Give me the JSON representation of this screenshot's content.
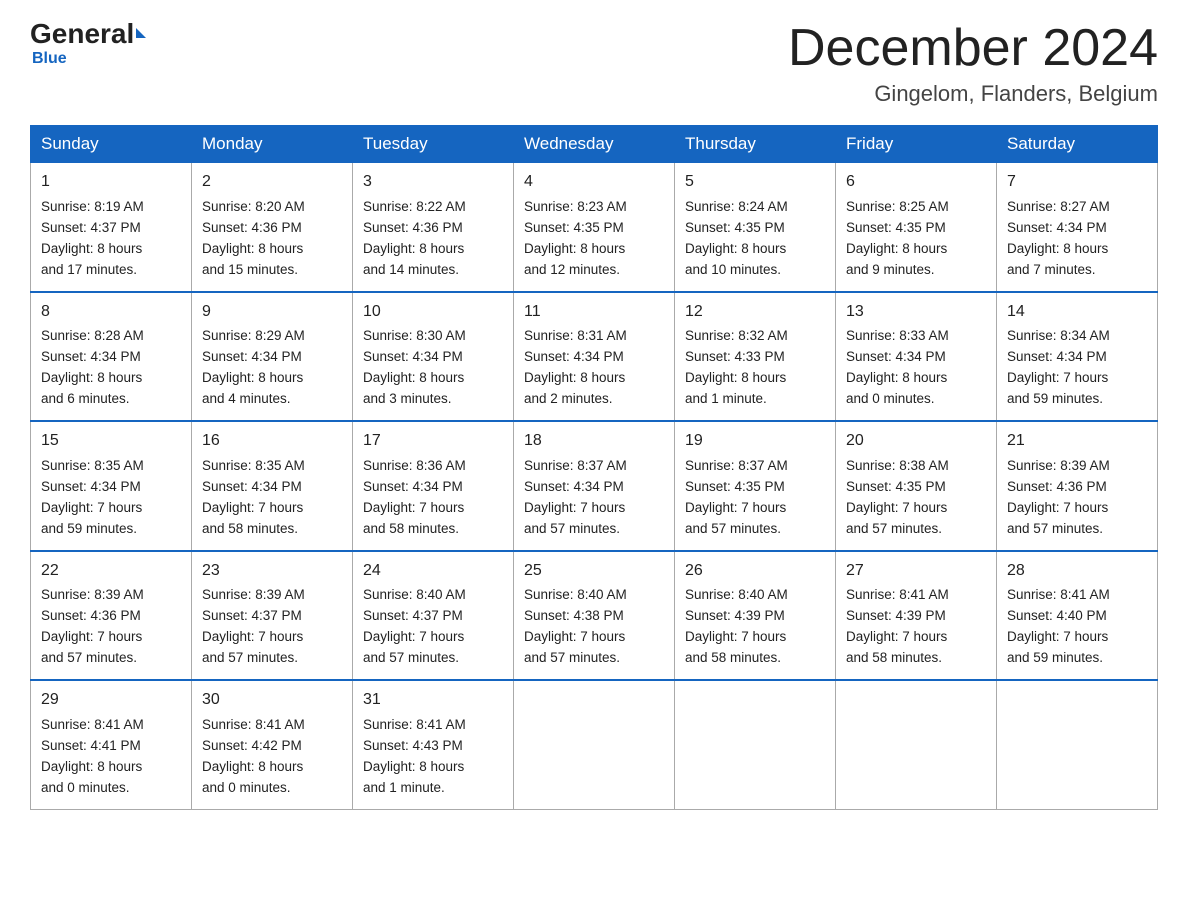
{
  "logo": {
    "general": "General",
    "blue": "Blue"
  },
  "header": {
    "month": "December 2024",
    "location": "Gingelom, Flanders, Belgium"
  },
  "weekdays": [
    "Sunday",
    "Monday",
    "Tuesday",
    "Wednesday",
    "Thursday",
    "Friday",
    "Saturday"
  ],
  "weeks": [
    [
      {
        "day": "1",
        "info": "Sunrise: 8:19 AM\nSunset: 4:37 PM\nDaylight: 8 hours\nand 17 minutes."
      },
      {
        "day": "2",
        "info": "Sunrise: 8:20 AM\nSunset: 4:36 PM\nDaylight: 8 hours\nand 15 minutes."
      },
      {
        "day": "3",
        "info": "Sunrise: 8:22 AM\nSunset: 4:36 PM\nDaylight: 8 hours\nand 14 minutes."
      },
      {
        "day": "4",
        "info": "Sunrise: 8:23 AM\nSunset: 4:35 PM\nDaylight: 8 hours\nand 12 minutes."
      },
      {
        "day": "5",
        "info": "Sunrise: 8:24 AM\nSunset: 4:35 PM\nDaylight: 8 hours\nand 10 minutes."
      },
      {
        "day": "6",
        "info": "Sunrise: 8:25 AM\nSunset: 4:35 PM\nDaylight: 8 hours\nand 9 minutes."
      },
      {
        "day": "7",
        "info": "Sunrise: 8:27 AM\nSunset: 4:34 PM\nDaylight: 8 hours\nand 7 minutes."
      }
    ],
    [
      {
        "day": "8",
        "info": "Sunrise: 8:28 AM\nSunset: 4:34 PM\nDaylight: 8 hours\nand 6 minutes."
      },
      {
        "day": "9",
        "info": "Sunrise: 8:29 AM\nSunset: 4:34 PM\nDaylight: 8 hours\nand 4 minutes."
      },
      {
        "day": "10",
        "info": "Sunrise: 8:30 AM\nSunset: 4:34 PM\nDaylight: 8 hours\nand 3 minutes."
      },
      {
        "day": "11",
        "info": "Sunrise: 8:31 AM\nSunset: 4:34 PM\nDaylight: 8 hours\nand 2 minutes."
      },
      {
        "day": "12",
        "info": "Sunrise: 8:32 AM\nSunset: 4:33 PM\nDaylight: 8 hours\nand 1 minute."
      },
      {
        "day": "13",
        "info": "Sunrise: 8:33 AM\nSunset: 4:34 PM\nDaylight: 8 hours\nand 0 minutes."
      },
      {
        "day": "14",
        "info": "Sunrise: 8:34 AM\nSunset: 4:34 PM\nDaylight: 7 hours\nand 59 minutes."
      }
    ],
    [
      {
        "day": "15",
        "info": "Sunrise: 8:35 AM\nSunset: 4:34 PM\nDaylight: 7 hours\nand 59 minutes."
      },
      {
        "day": "16",
        "info": "Sunrise: 8:35 AM\nSunset: 4:34 PM\nDaylight: 7 hours\nand 58 minutes."
      },
      {
        "day": "17",
        "info": "Sunrise: 8:36 AM\nSunset: 4:34 PM\nDaylight: 7 hours\nand 58 minutes."
      },
      {
        "day": "18",
        "info": "Sunrise: 8:37 AM\nSunset: 4:34 PM\nDaylight: 7 hours\nand 57 minutes."
      },
      {
        "day": "19",
        "info": "Sunrise: 8:37 AM\nSunset: 4:35 PM\nDaylight: 7 hours\nand 57 minutes."
      },
      {
        "day": "20",
        "info": "Sunrise: 8:38 AM\nSunset: 4:35 PM\nDaylight: 7 hours\nand 57 minutes."
      },
      {
        "day": "21",
        "info": "Sunrise: 8:39 AM\nSunset: 4:36 PM\nDaylight: 7 hours\nand 57 minutes."
      }
    ],
    [
      {
        "day": "22",
        "info": "Sunrise: 8:39 AM\nSunset: 4:36 PM\nDaylight: 7 hours\nand 57 minutes."
      },
      {
        "day": "23",
        "info": "Sunrise: 8:39 AM\nSunset: 4:37 PM\nDaylight: 7 hours\nand 57 minutes."
      },
      {
        "day": "24",
        "info": "Sunrise: 8:40 AM\nSunset: 4:37 PM\nDaylight: 7 hours\nand 57 minutes."
      },
      {
        "day": "25",
        "info": "Sunrise: 8:40 AM\nSunset: 4:38 PM\nDaylight: 7 hours\nand 57 minutes."
      },
      {
        "day": "26",
        "info": "Sunrise: 8:40 AM\nSunset: 4:39 PM\nDaylight: 7 hours\nand 58 minutes."
      },
      {
        "day": "27",
        "info": "Sunrise: 8:41 AM\nSunset: 4:39 PM\nDaylight: 7 hours\nand 58 minutes."
      },
      {
        "day": "28",
        "info": "Sunrise: 8:41 AM\nSunset: 4:40 PM\nDaylight: 7 hours\nand 59 minutes."
      }
    ],
    [
      {
        "day": "29",
        "info": "Sunrise: 8:41 AM\nSunset: 4:41 PM\nDaylight: 8 hours\nand 0 minutes."
      },
      {
        "day": "30",
        "info": "Sunrise: 8:41 AM\nSunset: 4:42 PM\nDaylight: 8 hours\nand 0 minutes."
      },
      {
        "day": "31",
        "info": "Sunrise: 8:41 AM\nSunset: 4:43 PM\nDaylight: 8 hours\nand 1 minute."
      },
      null,
      null,
      null,
      null
    ]
  ]
}
